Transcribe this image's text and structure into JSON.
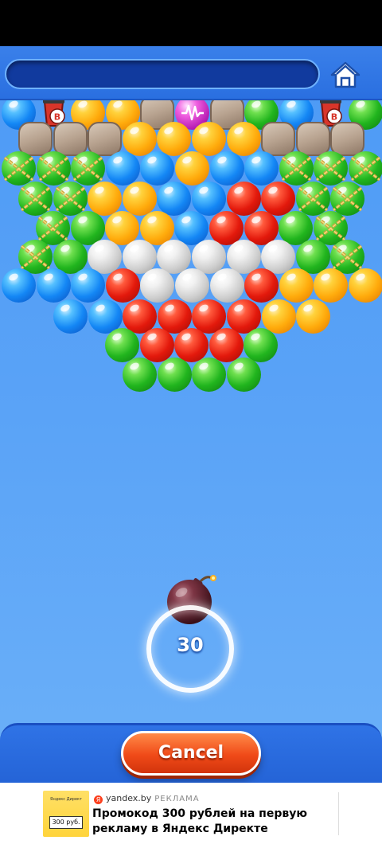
{
  "game": {
    "shots_remaining": "30",
    "cancel_label": "Cancel",
    "bottle_badge_letter": "B",
    "colors": {
      "background": "#5aa3f7",
      "top_bar": "#2a6fe0",
      "cancel_button": "#f04a18"
    },
    "board_rows": [
      [
        "blue",
        "bottle",
        "orange",
        "orange",
        "rock",
        "pink",
        "rock",
        "green",
        "blue",
        "bottle",
        "green"
      ],
      [
        "rock",
        "rock",
        "rock",
        "orange",
        "orange",
        "orange",
        "orange",
        "rock",
        "rock",
        "rock"
      ],
      [
        "green-chain",
        "green-chain",
        "green-chain",
        "blue",
        "blue",
        "orange",
        "blue",
        "blue",
        "green-chain",
        "green-chain",
        "green-chain"
      ],
      [
        "green-chain",
        "green-chain",
        "orange",
        "orange",
        "blue",
        "blue",
        "red",
        "red",
        "green-chain",
        "green-chain"
      ],
      [
        "green-chain",
        "green",
        "orange",
        "orange",
        "blue",
        "red",
        "red",
        "green",
        "green-chain"
      ],
      [
        "green-chain",
        "green",
        "silver",
        "silver",
        "silver",
        "silver",
        "silver",
        "silver",
        "green",
        "green-chain"
      ],
      [
        "blue",
        "blue",
        "blue",
        "red",
        "silver",
        "silver",
        "silver",
        "red",
        "orange",
        "orange",
        "orange"
      ],
      [
        "blue",
        "blue",
        "red",
        "red",
        "red",
        "red",
        "orange",
        "orange"
      ],
      [
        "green",
        "red",
        "red",
        "red",
        "green"
      ],
      [
        "green",
        "green",
        "green",
        "green"
      ]
    ]
  },
  "icons": {
    "home": "home-icon",
    "bomb": "bomb-icon"
  },
  "ad": {
    "source": "yandex.by",
    "source_logo_letter": "Я",
    "label": "РЕКЛАМА",
    "title": "Промокод 300 рублей на первую рекламу в Яндекс Директе",
    "thumb_caption": "Яндекс Директ",
    "thumb_price": "300 руб."
  }
}
